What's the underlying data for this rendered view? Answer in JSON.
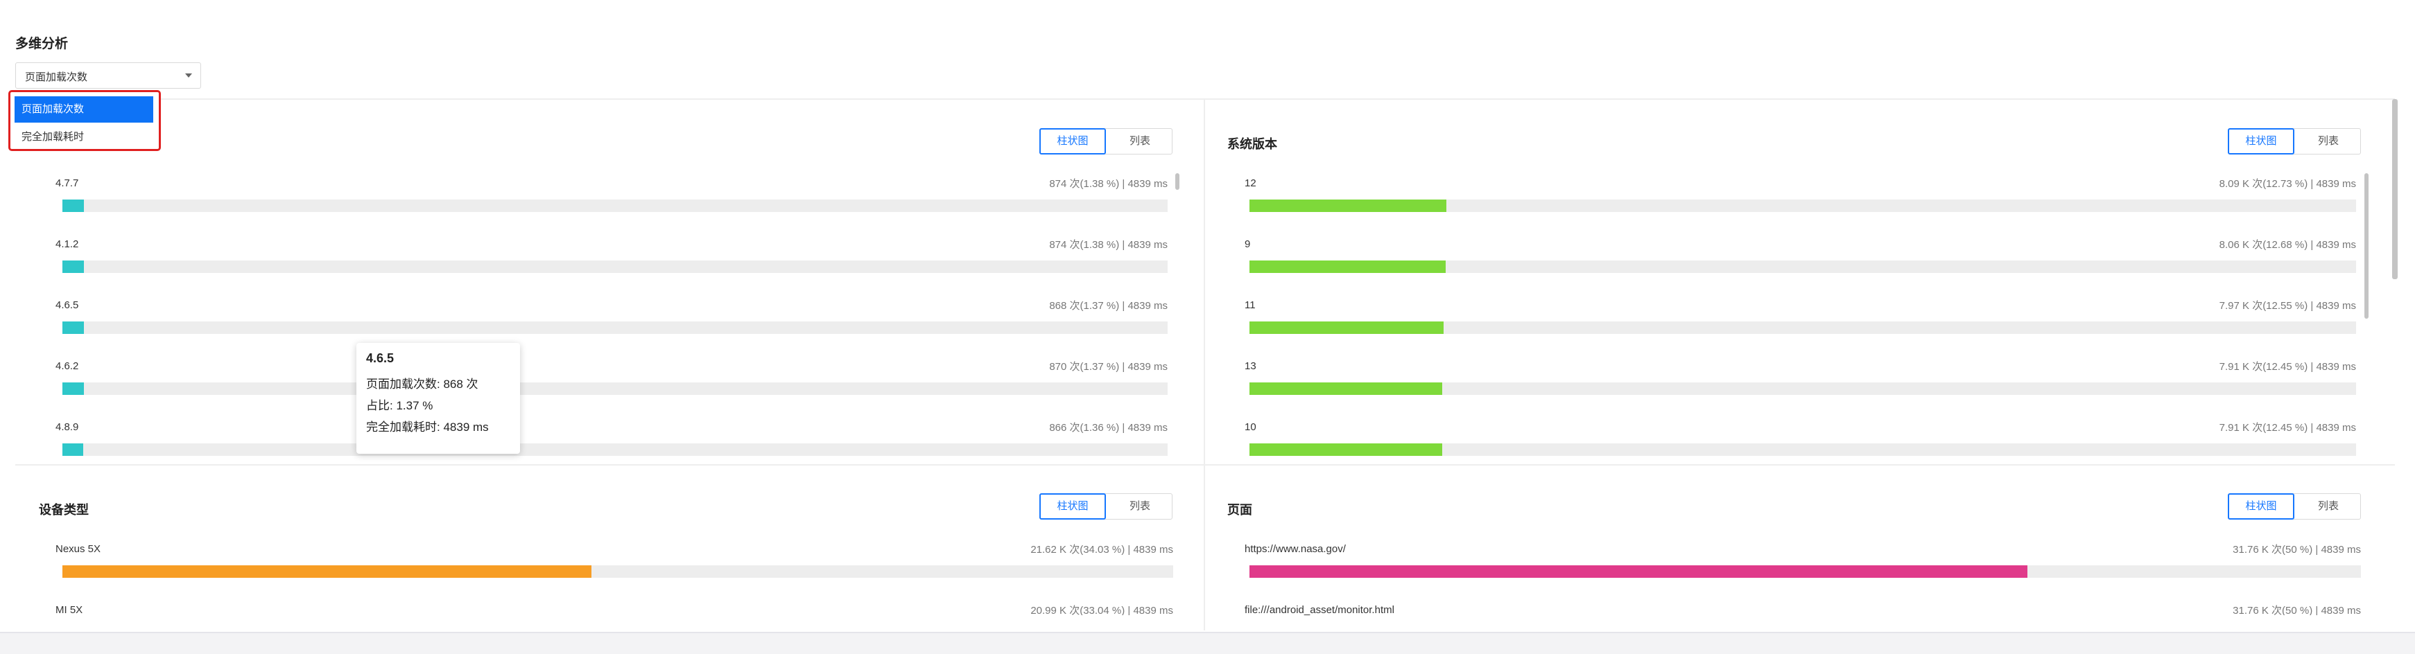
{
  "page": {
    "title": "多维分析"
  },
  "metric_select": {
    "value": "页面加载次数",
    "options": [
      "页面加载次数",
      "完全加载耗时"
    ]
  },
  "toggle": {
    "chart_label": "柱状图",
    "list_label": "列表"
  },
  "panels": {
    "app_version": {
      "title": "",
      "items": [
        {
          "label": "4.7.7",
          "stat": "874 次(1.38 %) | 4839 ms",
          "fraction": 0.0138,
          "color": "#2ec7c9"
        },
        {
          "label": "4.1.2",
          "stat": "874 次(1.38 %) | 4839 ms",
          "fraction": 0.0138,
          "color": "#2ec7c9"
        },
        {
          "label": "4.6.5",
          "stat": "868 次(1.37 %) | 4839 ms",
          "fraction": 0.0137,
          "color": "#2ec7c9"
        },
        {
          "label": "4.6.2",
          "stat": "870 次(1.37 %) | 4839 ms",
          "fraction": 0.0137,
          "color": "#2ec7c9"
        },
        {
          "label": "4.8.9",
          "stat": "866 次(1.36 %) | 4839 ms",
          "fraction": 0.0136,
          "color": "#2ec7c9"
        }
      ]
    },
    "os_version": {
      "title": "系统版本",
      "items": [
        {
          "label": "12",
          "stat": "8.09 K 次(12.73 %) | 4839 ms",
          "fraction": 0.1273,
          "color": "#7ed93a"
        },
        {
          "label": "9",
          "stat": "8.06 K 次(12.68 %) | 4839 ms",
          "fraction": 0.1268,
          "color": "#7ed93a"
        },
        {
          "label": "11",
          "stat": "7.97 K 次(12.55 %) | 4839 ms",
          "fraction": 0.1255,
          "color": "#7ed93a"
        },
        {
          "label": "13",
          "stat": "7.91 K 次(12.45 %) | 4839 ms",
          "fraction": 0.1245,
          "color": "#7ed93a"
        },
        {
          "label": "10",
          "stat": "7.91 K 次(12.45 %) | 4839 ms",
          "fraction": 0.1245,
          "color": "#7ed93a"
        }
      ]
    },
    "device_type": {
      "title": "设备类型",
      "items": [
        {
          "label": "Nexus 5X",
          "stat": "21.62 K 次(34.03 %) | 4839 ms",
          "fraction": 0.3403,
          "color": "#f79d24"
        },
        {
          "label": "MI 5X",
          "stat": "20.99 K 次(33.04 %) | 4839 ms",
          "fraction": 0.3304,
          "color": "#f79d24"
        }
      ]
    },
    "page": {
      "title": "页面",
      "items": [
        {
          "label": "https://www.nasa.gov/",
          "stat": "31.76 K 次(50 %) | 4839 ms",
          "fraction": 0.5,
          "color": "#e03a8a"
        },
        {
          "label": "file:///android_asset/monitor.html",
          "stat": "31.76 K 次(50 %) | 4839 ms",
          "fraction": 0.5,
          "color": "#e03a8a"
        }
      ]
    }
  },
  "tooltip": {
    "title": "4.6.5",
    "row1_label": "页面加载次数:",
    "row1_value": "868 次",
    "row2_label": "占比:",
    "row2_value": "1.37 %",
    "row3_label": "完全加载耗时:",
    "row3_value": "4839 ms"
  }
}
